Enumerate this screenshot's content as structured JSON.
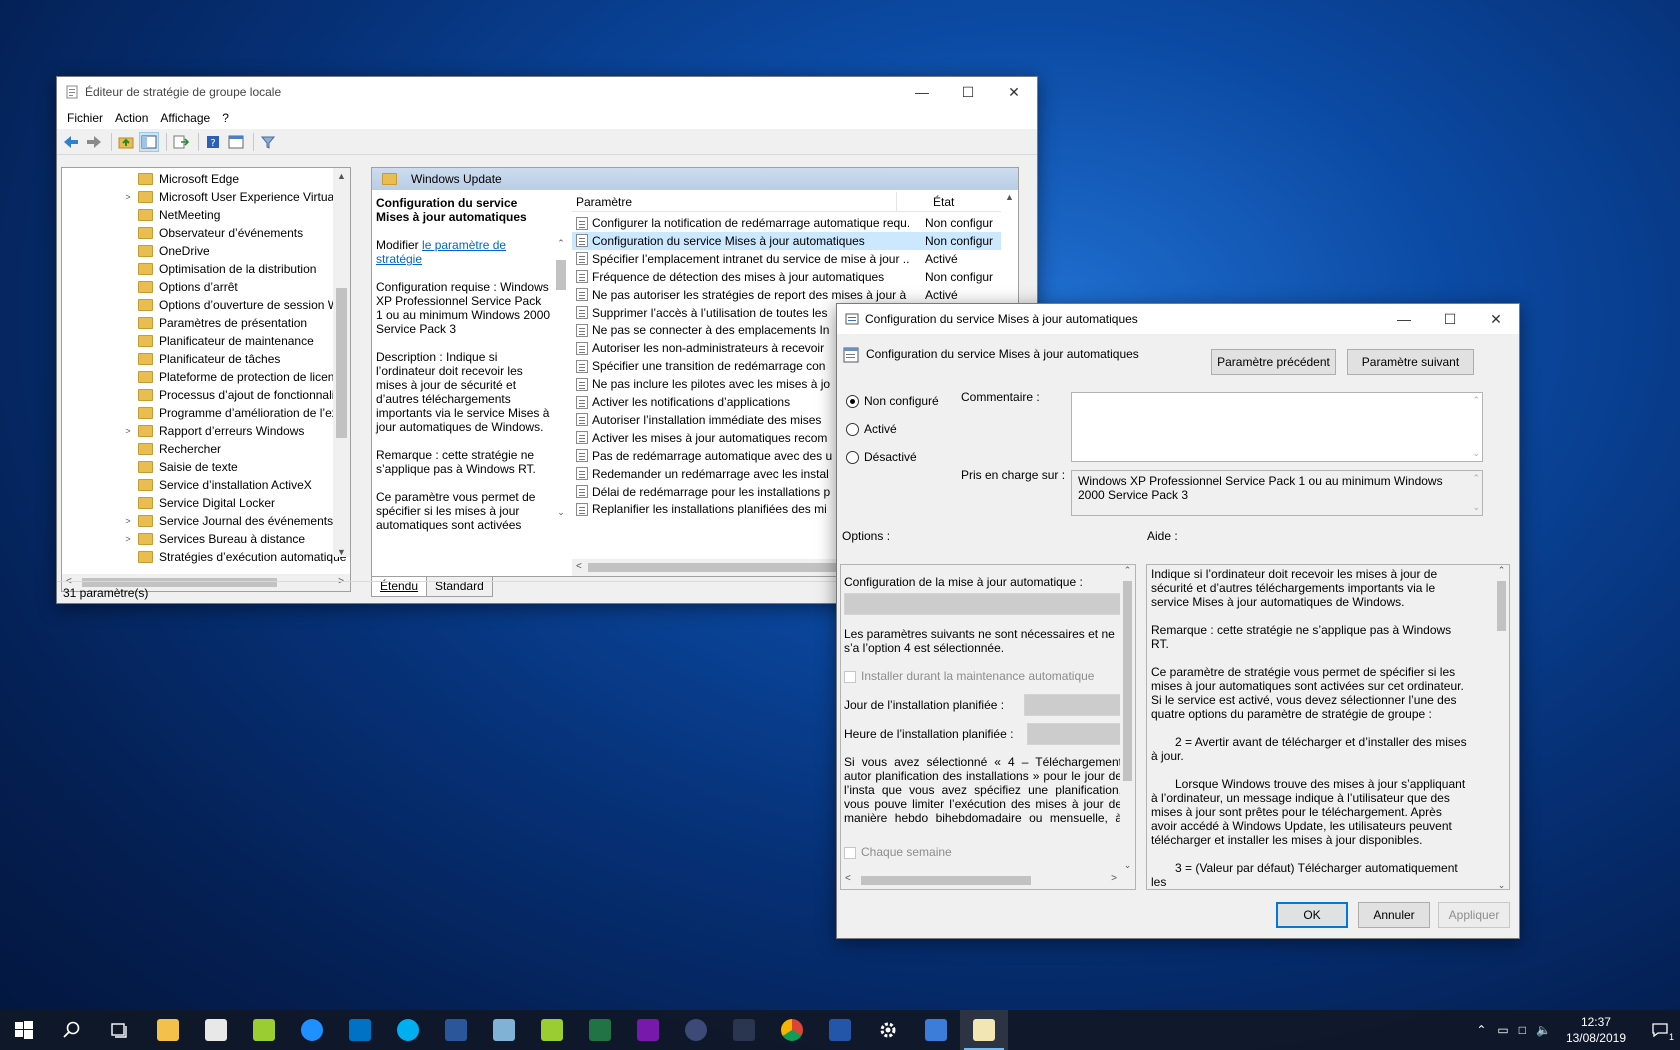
{
  "gpedit": {
    "title": "Éditeur de stratégie de groupe locale",
    "menu": [
      "Fichier",
      "Action",
      "Affichage",
      "?"
    ],
    "tree": [
      {
        "label": "Microsoft Edge",
        "exp": ""
      },
      {
        "label": "Microsoft User Experience Virtualiza",
        "exp": ">"
      },
      {
        "label": "NetMeeting",
        "exp": ""
      },
      {
        "label": "Observateur d’événements",
        "exp": ""
      },
      {
        "label": "OneDrive",
        "exp": ""
      },
      {
        "label": "Optimisation de la distribution",
        "exp": ""
      },
      {
        "label": "Options d’arrêt",
        "exp": ""
      },
      {
        "label": "Options d’ouverture de session Win",
        "exp": ""
      },
      {
        "label": "Paramètres de présentation",
        "exp": ""
      },
      {
        "label": "Planificateur de maintenance",
        "exp": ""
      },
      {
        "label": "Planificateur de tâches",
        "exp": ""
      },
      {
        "label": "Plateforme de protection de licence",
        "exp": ""
      },
      {
        "label": "Processus d’ajout de fonctionnalité",
        "exp": ""
      },
      {
        "label": "Programme d’amélioration de l’exp",
        "exp": ""
      },
      {
        "label": "Rapport d’erreurs Windows",
        "exp": ">"
      },
      {
        "label": "Rechercher",
        "exp": ""
      },
      {
        "label": "Saisie de texte",
        "exp": ""
      },
      {
        "label": "Service d’installation ActiveX",
        "exp": ""
      },
      {
        "label": "Service Digital Locker",
        "exp": ""
      },
      {
        "label": "Service Journal des événements",
        "exp": ">"
      },
      {
        "label": "Services Bureau à distance",
        "exp": ">"
      },
      {
        "label": "Stratégies d’exécution automatique",
        "exp": ""
      }
    ],
    "folder_header": "Windows Update",
    "desc_title": "Configuration du service Mises à jour automatiques",
    "desc_modify": "Modifier",
    "desc_link": "le paramètre de stratégie",
    "desc_req": "Configuration requise : Windows XP Professionnel Service Pack 1 ou au minimum Windows 2000 Service Pack 3",
    "desc_body": "Description : Indique si l’ordinateur doit recevoir les mises à jour de sécurité et d’autres téléchargements importants via le service Mises à jour automatiques de Windows.",
    "desc_note": "Remarque : cette stratégie ne s’applique pas à Windows RT.",
    "desc_more": "Ce paramètre vous permet de spécifier si les mises à jour automatiques sont activées",
    "col_param": "Paramètre",
    "col_state": "État",
    "rows": [
      {
        "name": "Configurer la notification de redémarrage automatique requ...",
        "state": "Non configur"
      },
      {
        "name": "Configuration du service Mises à jour automatiques",
        "state": "Non configur"
      },
      {
        "name": "Spécifier l’emplacement intranet du service de mise à jour ...",
        "state": "Activé"
      },
      {
        "name": "Fréquence de détection des mises à jour automatiques",
        "state": "Non configur"
      },
      {
        "name": "Ne pas autoriser les stratégies de report des mises à jour à ef...",
        "state": "Activé"
      },
      {
        "name": "Supprimer l’accès à l’utilisation de toutes les",
        "state": ""
      },
      {
        "name": "Ne pas se connecter à des emplacements In",
        "state": ""
      },
      {
        "name": "Autoriser les non-administrateurs à recevoir",
        "state": ""
      },
      {
        "name": "Spécifier une transition de redémarrage con",
        "state": ""
      },
      {
        "name": "Ne pas inclure les pilotes avec les mises à jo",
        "state": ""
      },
      {
        "name": "Activer les notifications d’applications",
        "state": ""
      },
      {
        "name": "Autoriser l’installation immédiate des mises",
        "state": ""
      },
      {
        "name": "Activer les mises à jour automatiques recom",
        "state": ""
      },
      {
        "name": "Pas de redémarrage automatique avec des u",
        "state": ""
      },
      {
        "name": "Redemander un redémarrage avec les instal",
        "state": ""
      },
      {
        "name": "Délai de redémarrage pour les installations p",
        "state": ""
      },
      {
        "name": "Replanifier les installations planifiées des mi",
        "state": ""
      }
    ],
    "tabs": [
      "Étendu",
      "Standard"
    ],
    "status": "31 paramètre(s)"
  },
  "dialog": {
    "title": "Configuration du service Mises à jour automatiques",
    "subtitle": "Configuration du service Mises à jour automatiques",
    "prev_btn": "Paramètre précédent",
    "next_btn": "Paramètre suivant",
    "radio_notconf": "Non configuré",
    "radio_enabled": "Activé",
    "radio_disabled": "Désactivé",
    "comment_label": "Commentaire :",
    "supported_label": "Pris en charge sur :",
    "supported_value": "Windows XP Professionnel Service Pack 1 ou au minimum Windows 2000 Service Pack 3",
    "options_label": "Options :",
    "help_label": "Aide :",
    "opt_config": "Configuration de la mise à jour automatique :",
    "opt_note": "Les paramètres suivants ne sont nécessaires et ne s’a l’option 4 est sélectionnée.",
    "opt_maint": "Installer durant la maintenance automatique",
    "opt_day": "Jour de l’installation planifiée :",
    "opt_hour": "Heure de l’installation planifiée :",
    "opt_para": "Si vous avez sélectionné « 4 – Téléchargement autor planification des installations » pour le jour de l’insta que vous avez spécifiez une planification, vous pouve limiter l’exécution des mises à jour de manière hebdo bihebdomadaire ou mensuelle, à l’aide des options",
    "opt_weekly": "Chaque semaine",
    "help": [
      "Indique si l’ordinateur doit recevoir les mises à jour de sécurité et d’autres téléchargements importants via le service Mises à jour automatiques de Windows.",
      "Remarque : cette stratégie ne s’applique pas à Windows RT.",
      "Ce paramètre de stratégie vous permet de spécifier si les mises à jour automatiques sont activées sur cet ordinateur. Si le service est activé, vous devez sélectionner l’une des quatre options du paramètre de stratégie de groupe :",
      "2 = Avertir avant de télécharger et d’installer des mises à jour.",
      "Lorsque Windows trouve des mises à jour s’appliquant à l’ordinateur, un message indique à l’utilisateur que des mises à jour sont prêtes pour le téléchargement. Après avoir accédé à Windows Update, les utilisateurs peuvent télécharger et installer les mises à jour disponibles.",
      "3 = (Valeur par défaut) Télécharger automatiquement les"
    ],
    "ok": "OK",
    "cancel": "Annuler",
    "apply": "Appliquer"
  },
  "taskbar": {
    "time": "12:37",
    "date": "13/08/2019",
    "notif_count": "1"
  },
  "colors": {
    "accent": "#0078d7",
    "selection": "#cce8ff"
  }
}
